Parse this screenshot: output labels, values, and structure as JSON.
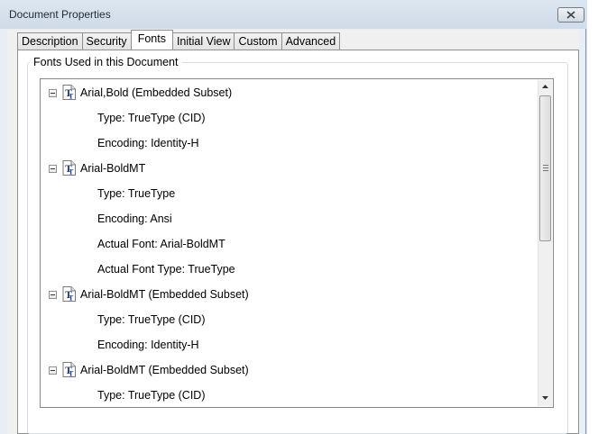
{
  "window": {
    "title": "Document Properties"
  },
  "tabs": [
    {
      "label": "Description",
      "active": false
    },
    {
      "label": "Security",
      "active": false
    },
    {
      "label": "Fonts",
      "active": true
    },
    {
      "label": "Initial View",
      "active": false
    },
    {
      "label": "Custom",
      "active": false
    },
    {
      "label": "Advanced",
      "active": false
    }
  ],
  "fonts_panel": {
    "group_label": "Fonts Used in this Document",
    "tree": [
      {
        "kind": "font",
        "text": "Arial,Bold (Embedded Subset)",
        "icon": "truetype-font-icon"
      },
      {
        "kind": "detail",
        "text": "Type: TrueType (CID)"
      },
      {
        "kind": "detail",
        "text": "Encoding: Identity-H"
      },
      {
        "kind": "font",
        "text": "Arial-BoldMT",
        "icon": "truetype-font-icon"
      },
      {
        "kind": "detail",
        "text": "Type: TrueType"
      },
      {
        "kind": "detail",
        "text": "Encoding: Ansi"
      },
      {
        "kind": "detail",
        "text": "Actual Font: Arial-BoldMT"
      },
      {
        "kind": "detail",
        "text": "Actual Font Type: TrueType"
      },
      {
        "kind": "font",
        "text": "Arial-BoldMT (Embedded Subset)",
        "icon": "truetype-font-icon"
      },
      {
        "kind": "detail",
        "text": "Type: TrueType (CID)"
      },
      {
        "kind": "detail",
        "text": "Encoding: Identity-H"
      },
      {
        "kind": "font",
        "text": "Arial-BoldMT (Embedded Subset)",
        "icon": "truetype-font-icon"
      },
      {
        "kind": "detail",
        "text": "Type: TrueType (CID)"
      }
    ]
  },
  "icons": {
    "close": "close-icon",
    "expander": "collapse-minus-icon",
    "scroll_up": "scroll-up-arrow-icon",
    "scroll_down": "scroll-down-arrow-icon"
  },
  "colors": {
    "titlebar": "#cfdbe8",
    "panel": "#ffffff",
    "font_icon_blue": "#1f3f9a"
  }
}
